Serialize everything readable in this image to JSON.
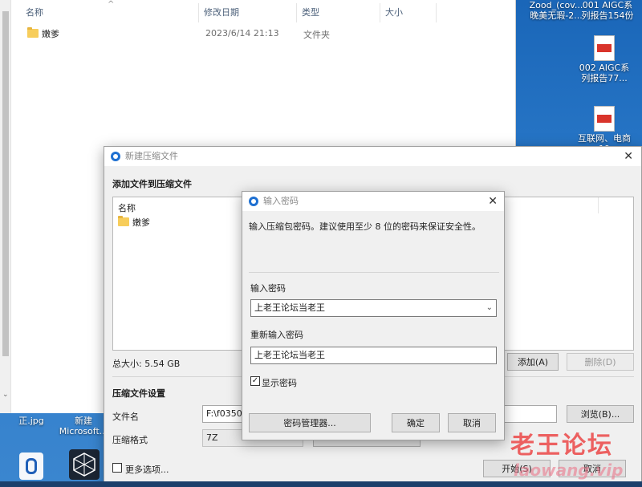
{
  "explorer": {
    "columns": [
      "名称",
      "修改日期",
      "类型",
      "大小"
    ],
    "rows": [
      {
        "name": "嫩爹",
        "date": "2023/6/14 21:13",
        "type": "文件夹",
        "size": ""
      }
    ],
    "sort_arrow": "^"
  },
  "desktop": {
    "icons": [
      {
        "label_1": "Zood_(cov...",
        "label_2": "晚美无瑕-2..."
      },
      {
        "label_1": "001 AIGC系",
        "label_2": "列报告154份"
      },
      {
        "label_1": "002 AIGC系",
        "label_2": "列报告77..."
      },
      {
        "label_1": "互联网、电商",
        "label_2": "19"
      },
      {
        "label_1": "正.jpg",
        "label_2": ""
      },
      {
        "label_1": "新建",
        "label_2": "Microsoft..."
      }
    ]
  },
  "create_archive": {
    "title": "新建压缩文件",
    "section_add": "添加文件到压缩文件",
    "list_header": "名称",
    "list_items": [
      "嫩爹"
    ],
    "total_size": "总大小: 5.54 GB",
    "add_button": "添加(A)",
    "delete_button": "删除(D)",
    "section_settings": "压缩文件设置",
    "filename_label": "文件名",
    "filename_value": "F:\\f03507",
    "browse_button": "浏览(B)...",
    "format_label": "压缩格式",
    "format_value": "7Z",
    "more_options": "更多选项...",
    "start_button": "开始(S)",
    "cancel_button": "取消"
  },
  "password_dialog": {
    "title": "输入密码",
    "message": "输入压缩包密码。建议使用至少 8 位的密码来保证安全性。",
    "password_label": "输入密码",
    "password_value": "上老王论坛当老王",
    "reenter_label": "重新输入密码",
    "reenter_value": "上老王论坛当老王",
    "show_password_label": "显示密码",
    "show_password_checked": true,
    "manager_button": "密码管理器...",
    "ok_button": "确定",
    "cancel_button": "取消"
  },
  "watermark": {
    "cn": "老王论坛",
    "en": "laowang.vip"
  }
}
